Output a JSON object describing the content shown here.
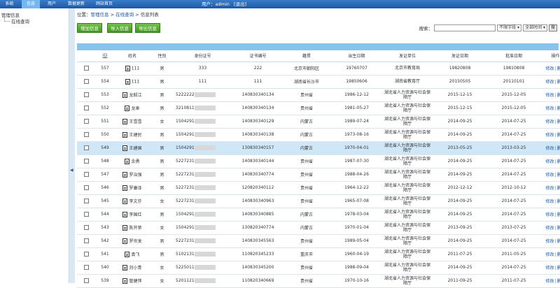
{
  "nav": {
    "tabs": [
      "系统",
      "信息",
      "用户",
      "数据更新",
      "网站首页"
    ],
    "active_index": 1
  },
  "header": {
    "user_label": "用户：admin",
    "logout": "[退出]"
  },
  "sidebar": {
    "title": "管理信息",
    "items": [
      "在线查询"
    ]
  },
  "breadcrumb": {
    "prefix": "位置：",
    "items": [
      "管理信息",
      "在线查询",
      "信息列表"
    ],
    "sep": " > "
  },
  "toolbar": {
    "add": "增加信息",
    "import": "导入信息",
    "export": "导出信息"
  },
  "search": {
    "label": "搜索：",
    "field_select": "不限字段",
    "time_select": "全部时间",
    "go": "搜"
  },
  "table": {
    "columns": [
      "",
      "ID",
      "姓名",
      "性别",
      "身份证号",
      "证书编号",
      "籍贯",
      "出生日期",
      "发证单位",
      "发证日期",
      "批准日期",
      "操作"
    ],
    "edit": "修改",
    "delete": "删除",
    "op_sep": "|",
    "rows": [
      {
        "id": "557",
        "name": "111",
        "gender": "男",
        "idno": "333",
        "idno_redacted": false,
        "cert": "222",
        "origin": "北京市朝阳区",
        "birth": "19760707",
        "issuer": "北京市教育局",
        "issue": "19820808",
        "approve": "19810808"
      },
      {
        "id": "554",
        "name": "111",
        "gender": "男",
        "idno": "111",
        "idno_redacted": false,
        "cert": "111",
        "origin": "湖南省长沙市",
        "birth": "19850606",
        "issuer": "湖南省教育厅",
        "issue": "20150505",
        "approve": "20110101"
      },
      {
        "id": "553",
        "name": "龙毅江",
        "gender": "男",
        "idno": "5222222",
        "idno_redacted": true,
        "cert": "140830340134",
        "origin": "贵州省",
        "birth": "1986-12-12",
        "issuer": "湖北省人力资源与社会保障厅",
        "issue": "2015-12-15",
        "approve": "2015-12-05"
      },
      {
        "id": "552",
        "name": "龙奉",
        "gender": "男",
        "idno": "3210811",
        "idno_redacted": true,
        "cert": "140830340134",
        "origin": "贵州省",
        "birth": "1981-05-27",
        "issuer": "湖北省人力资源与社会保障厅",
        "issue": "2015-12-15",
        "approve": "2015-12-05"
      },
      {
        "id": "551",
        "name": "王雪雪",
        "gender": "女",
        "idno": "1504291",
        "idno_redacted": true,
        "cert": "140830340129",
        "origin": "内蒙古",
        "birth": "1989-07-24",
        "issuer": "湖北省人力资源与社会保障厅",
        "issue": "2014-09-25",
        "approve": "2014-07-25"
      },
      {
        "id": "550",
        "name": "王建民",
        "gender": "男",
        "idno": "1504291",
        "idno_redacted": true,
        "cert": "140830340138",
        "origin": "内蒙古",
        "birth": "1973-08-16",
        "issuer": "湖北省人力资源与社会保障厅",
        "issue": "2014-09-25",
        "approve": "2014-07-25"
      },
      {
        "id": "549",
        "name": "王建国",
        "gender": "男",
        "idno": "1504291",
        "idno_redacted": true,
        "cert": "130830340157",
        "origin": "内蒙古",
        "birth": "1970-04-01",
        "issuer": "湖北省人力资源与社会保障厅",
        "issue": "2013-05-25",
        "approve": "2013-03-25"
      },
      {
        "id": "548",
        "name": "余勇",
        "gender": "男",
        "idno": "5227231",
        "idno_redacted": true,
        "cert": "140830340144",
        "origin": "贵州省",
        "birth": "1987-07-30",
        "issuer": "湖北省人力资源与社会保障厅",
        "issue": "2014-09-25",
        "approve": "2014-07-25"
      },
      {
        "id": "547",
        "name": "罗治强",
        "gender": "男",
        "idno": "5227231",
        "idno_redacted": true,
        "cert": "140830340774",
        "origin": "贵州省",
        "birth": "1988-04-26",
        "issuer": "湖北省人力资源与社会保障厅",
        "issue": "2014-09-25",
        "approve": "2014-07-25"
      },
      {
        "id": "546",
        "name": "罗康泽",
        "gender": "男",
        "idno": "5227231",
        "idno_redacted": true,
        "cert": "120820340112",
        "origin": "贵州省",
        "birth": "1964-12-22",
        "issuer": "湖北省人力资源与社会保障厅",
        "issue": "2012-12-12",
        "approve": "2012-10-12"
      },
      {
        "id": "545",
        "name": "李文芬",
        "gender": "女",
        "idno": "5227231",
        "idno_redacted": true,
        "cert": "140830340963",
        "origin": "贵州省",
        "birth": "1965-07-08",
        "issuer": "湖北省人力资源与社会保障厅",
        "issue": "2014-09-25",
        "approve": "2014-07-25"
      },
      {
        "id": "544",
        "name": "李国红",
        "gender": "男",
        "idno": "1504291",
        "idno_redacted": true,
        "cert": "140830340885",
        "origin": "内蒙古",
        "birth": "1978-03-04",
        "issuer": "湖北省人力资源与社会保障厅",
        "issue": "2014-09-25",
        "approve": "2014-07-25"
      },
      {
        "id": "543",
        "name": "陈开荣",
        "gender": "女",
        "idno": "1504291",
        "idno_redacted": true,
        "cert": "130820340774",
        "origin": "内蒙古",
        "birth": "1970-01-04",
        "issuer": "湖北省人力资源与社会保障厅",
        "issue": "2013-09-25",
        "approve": "2013-07-25"
      },
      {
        "id": "542",
        "name": "罗世发",
        "gender": "男",
        "idno": "5227231",
        "idno_redacted": true,
        "cert": "140830345563",
        "origin": "贵州省",
        "birth": "1989-05-04",
        "issuer": "湖北省人力资源与社会保障厅",
        "issue": "2014-09-25",
        "approve": "2014-07-25"
      },
      {
        "id": "541",
        "name": "袁飞",
        "gender": "男",
        "idno": "5102131",
        "idno_redacted": true,
        "cert": "110820345233",
        "origin": "重庆市",
        "birth": "1960-04-19",
        "issuer": "湖北省人力资源与社会保障厅",
        "issue": "2011-07-25",
        "approve": "2011-05-25"
      },
      {
        "id": "540",
        "name": "刘小青",
        "gender": "女",
        "idno": "5225011",
        "idno_redacted": true,
        "cert": "140830345200",
        "origin": "贵州省",
        "birth": "1988-09-04",
        "issuer": "湖北省人力资源与社会保障厅",
        "issue": "2014-09-25",
        "approve": "2014-07-25"
      },
      {
        "id": "539",
        "name": "管健萍",
        "gender": "女",
        "idno": "5201121",
        "idno_redacted": true,
        "cert": "110820340669",
        "origin": "贵州省",
        "birth": "1970-10-16",
        "issuer": "湖北省人力资源与社会保障厅",
        "issue": "2011-09-25",
        "approve": "2011-07-25"
      }
    ],
    "highlight_index": 6
  },
  "colors": {
    "topbar": "#1b58a8",
    "active_tab": "#74b7f2",
    "band": "#88c3ec",
    "highlight_row": "#cfe7f7",
    "green_button": "#4fa82a",
    "link": "#1b58a8"
  }
}
